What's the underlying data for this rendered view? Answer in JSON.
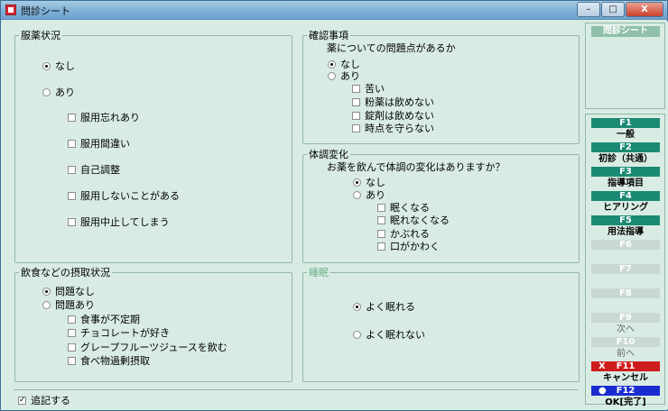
{
  "window": {
    "title": "問診シート",
    "buttons": {
      "minimize": "–",
      "maximize": "□",
      "close": "X"
    }
  },
  "medication": {
    "title": "服薬状況",
    "none": "なし",
    "some": "あり",
    "options": [
      "服用忘れあり",
      "服用間違い",
      "自己調整",
      "服用しないことがある",
      "服用中止してしまう"
    ]
  },
  "confirm": {
    "title": "確認事項",
    "question": "薬についての問題点があるか",
    "none": "なし",
    "some": "あり",
    "options": [
      "苦い",
      "粉薬は飲めない",
      "錠剤は飲めない",
      "時点を守らない"
    ]
  },
  "condition": {
    "title": "体調変化",
    "question": "お薬を飲んで体調の変化はありますか？",
    "none": "なし",
    "some": "あり",
    "options": [
      "眠くなる",
      "眠れなくなる",
      "かぶれる",
      "口がかわく"
    ]
  },
  "diet": {
    "title": "飲食などの摂取状況",
    "none": "問題なし",
    "some": "問題あり",
    "options": [
      "食事が不定期",
      "チョコレートが好き",
      "グレープフルーツジュースを飲む",
      "食べ物過剰摂取"
    ]
  },
  "sleep": {
    "title": "睡眠",
    "good": "よく眠れる",
    "bad": "よく眠れない"
  },
  "footer": {
    "append": "追記する",
    "check_mark": "✓"
  },
  "sidebar": {
    "title": "問診シート",
    "keys": [
      {
        "key": "F1",
        "label": "一般"
      },
      {
        "key": "F2",
        "label": "初診（共通）"
      },
      {
        "key": "F3",
        "label": "指導項目"
      },
      {
        "key": "F4",
        "label": "ヒアリング"
      },
      {
        "key": "F5",
        "label": "用法指導"
      },
      {
        "key": "F6",
        "label": ""
      },
      {
        "key": "F7",
        "label": ""
      },
      {
        "key": "F8",
        "label": ""
      },
      {
        "key": "F9",
        "label": "次へ"
      },
      {
        "key": "F10",
        "label": "前へ"
      },
      {
        "key": "F11",
        "label": "キャンセル",
        "mark": "X"
      },
      {
        "key": "F12",
        "label": "OK[完了]",
        "mark": "●"
      }
    ]
  },
  "colors": {
    "background": "#d9ece4",
    "fkey": "#1a8a74",
    "cancel": "#cf1d1d",
    "ok": "#1a2bd1"
  }
}
